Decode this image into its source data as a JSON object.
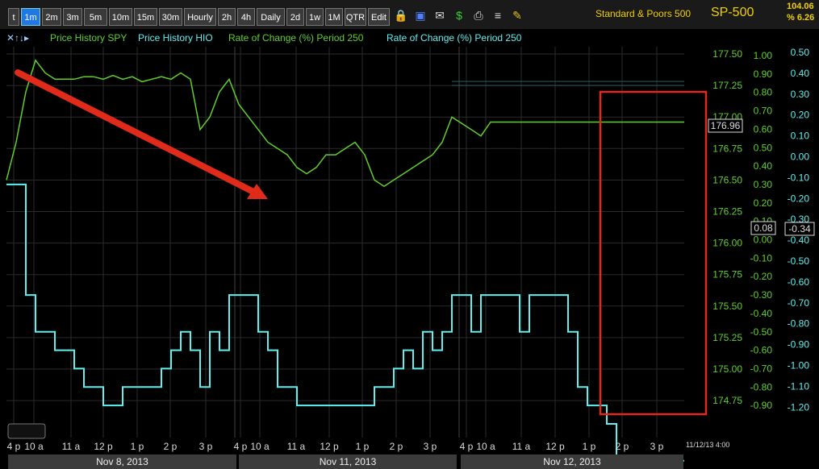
{
  "toolbar": {
    "buttons": [
      "t",
      "1m",
      "2m",
      "3m",
      "5m",
      "10m",
      "15m",
      "30m",
      "Hourly",
      "2h",
      "4h",
      "Daily",
      "2d",
      "1w",
      "1M",
      "QTR",
      "Edit"
    ],
    "active": "1m",
    "icons": [
      "lock-icon",
      "save-icon",
      "mail-icon",
      "dollar-icon",
      "print-icon",
      "list-icon",
      "pencil-icon"
    ]
  },
  "symbol": {
    "name": "Standard & Poors 500",
    "ticker": "SP-500",
    "quote_line1": "104.06",
    "quote_line2": "% 6.26"
  },
  "legend": {
    "controls": "✕↑↓▸",
    "items": [
      {
        "label": "Price History SPY",
        "color": "#5fd02a"
      },
      {
        "label": "Price History HIO",
        "color": "#5ff0f0"
      },
      {
        "label": "Rate of Change (%) Period 250",
        "color": "#5fd02a"
      },
      {
        "label": "Rate of Change (%) Period 250",
        "color": "#5ff0f0"
      }
    ]
  },
  "chart_data": {
    "type": "line",
    "x_tick_labels": [
      "4 p",
      "10 a",
      "11 a",
      "12 p",
      "1 p",
      "2 p",
      "3 p",
      "4 p",
      "10 a",
      "11 a",
      "12 p",
      "1 p",
      "2 p",
      "3 p",
      "4 p",
      "10 a",
      "11 a",
      "12 p",
      "1 p",
      "2 p",
      "3 p"
    ],
    "date_labels": [
      "Nov 8, 2013",
      "Nov 11, 2013",
      "Nov 12, 2013"
    ],
    "timestamp": "11/12/13 4:00",
    "axes": {
      "price": {
        "ticks": [
          "177.50",
          "177.25",
          "177.00",
          "176.75",
          "176.50",
          "176.25",
          "176.00",
          "175.75",
          "175.50",
          "175.25",
          "175.00",
          "174.75"
        ],
        "range": [
          174.75,
          177.5
        ],
        "color": "#5fd02a"
      },
      "roc_spy": {
        "ticks": [
          "1.00",
          "0.90",
          "0.80",
          "0.70",
          "0.60",
          "0.50",
          "0.40",
          "0.30",
          "0.20",
          "0.10",
          "0.00",
          "-0.10",
          "-0.20",
          "-0.30",
          "-0.40",
          "-0.50",
          "-0.60",
          "-0.70",
          "-0.80",
          "-0.90"
        ],
        "range": [
          -0.9,
          1.0
        ],
        "color": "#5fd02a"
      },
      "roc_hio": {
        "ticks": [
          "0.50",
          "0.40",
          "0.30",
          "0.20",
          "0.10",
          "0.00",
          "-0.10",
          "-0.20",
          "-0.30",
          "-0.40",
          "-0.50",
          "-0.60",
          "-0.70",
          "-0.80",
          "-0.90",
          "-1.00",
          "-1.10",
          "-1.20"
        ],
        "range": [
          -1.2,
          0.5
        ],
        "color": "#5ff0f0"
      }
    },
    "last_values": {
      "price": "176.96",
      "roc_spy": "0.08",
      "roc_hio": "-0.34"
    },
    "series": [
      {
        "name": "Price History SPY",
        "color": "#5fd02a",
        "x": [
          0,
          3,
          6,
          9,
          12,
          15,
          18,
          21,
          24,
          27,
          30,
          33,
          36,
          39,
          42,
          45,
          48,
          51,
          54,
          57,
          60,
          63,
          66,
          69,
          72,
          75,
          78,
          81,
          84,
          87,
          90,
          93,
          96,
          99,
          102,
          105,
          108,
          111,
          114,
          117,
          120,
          123,
          126,
          129,
          132,
          135,
          138,
          141,
          144,
          147,
          150,
          153,
          156,
          159,
          162,
          165,
          168,
          171,
          174,
          177,
          180,
          183,
          186,
          189,
          192,
          195,
          198,
          201,
          204,
          207,
          210
        ],
        "y": [
          176.5,
          176.8,
          177.2,
          177.45,
          177.35,
          177.3,
          177.3,
          177.3,
          177.32,
          177.32,
          177.3,
          177.33,
          177.3,
          177.32,
          177.28,
          177.3,
          177.32,
          177.3,
          177.35,
          177.3,
          176.9,
          177.0,
          177.2,
          177.3,
          177.1,
          177.0,
          176.9,
          176.8,
          176.75,
          176.7,
          176.6,
          176.55,
          176.6,
          176.7,
          176.7,
          176.75,
          176.8,
          176.7,
          176.5,
          176.45,
          176.5,
          176.55,
          176.6,
          176.65,
          176.7,
          176.8,
          177.0,
          176.95,
          176.9,
          176.85,
          176.96,
          176.96,
          176.96,
          176.96,
          176.96,
          176.96,
          176.96,
          176.96,
          176.96,
          176.96,
          176.96,
          176.96,
          176.96,
          176.96,
          176.96,
          176.96,
          176.96,
          176.96,
          176.96,
          176.96,
          176.96
        ]
      },
      {
        "name": "Rate of Change (%) Period 250",
        "color": "#5ff0f0",
        "x": [
          0,
          3,
          6,
          9,
          12,
          15,
          18,
          21,
          24,
          27,
          30,
          33,
          36,
          39,
          42,
          45,
          48,
          51,
          54,
          57,
          60,
          63,
          66,
          69,
          72,
          75,
          78,
          81,
          84,
          87,
          90,
          93,
          96,
          99,
          102,
          105,
          108,
          111,
          114,
          117,
          120,
          123,
          126,
          129,
          132,
          135,
          138,
          141,
          144,
          147,
          150,
          153,
          156,
          159,
          162,
          165,
          168,
          171,
          174,
          177,
          180,
          183,
          186,
          189,
          192,
          195,
          198,
          201,
          204,
          207,
          210
        ],
        "y": [
          0.3,
          0.3,
          -0.3,
          -0.5,
          -0.5,
          -0.6,
          -0.6,
          -0.7,
          -0.8,
          -0.8,
          -0.9,
          -0.9,
          -0.8,
          -0.8,
          -0.8,
          -0.8,
          -0.7,
          -0.6,
          -0.5,
          -0.6,
          -0.8,
          -0.5,
          -0.6,
          -0.3,
          -0.3,
          -0.3,
          -0.5,
          -0.6,
          -0.8,
          -0.8,
          -0.9,
          -0.9,
          -0.9,
          -0.9,
          -0.9,
          -0.9,
          -0.9,
          -0.9,
          -0.8,
          -0.8,
          -0.7,
          -0.6,
          -0.7,
          -0.5,
          -0.6,
          -0.5,
          -0.3,
          -0.3,
          -0.5,
          -0.3,
          -0.3,
          -0.3,
          -0.3,
          -0.5,
          -0.3,
          -0.3,
          -0.3,
          -0.3,
          -0.5,
          -0.8,
          -0.9,
          -0.9,
          -1.0,
          -1.2,
          -1.2,
          -1.2,
          -1.2,
          -1.2,
          -1.2,
          -1.2,
          -1.2
        ]
      }
    ],
    "annotations": [
      {
        "type": "arrow",
        "color": "#e02a1a"
      },
      {
        "type": "box",
        "color": "#e02a1a"
      }
    ]
  }
}
